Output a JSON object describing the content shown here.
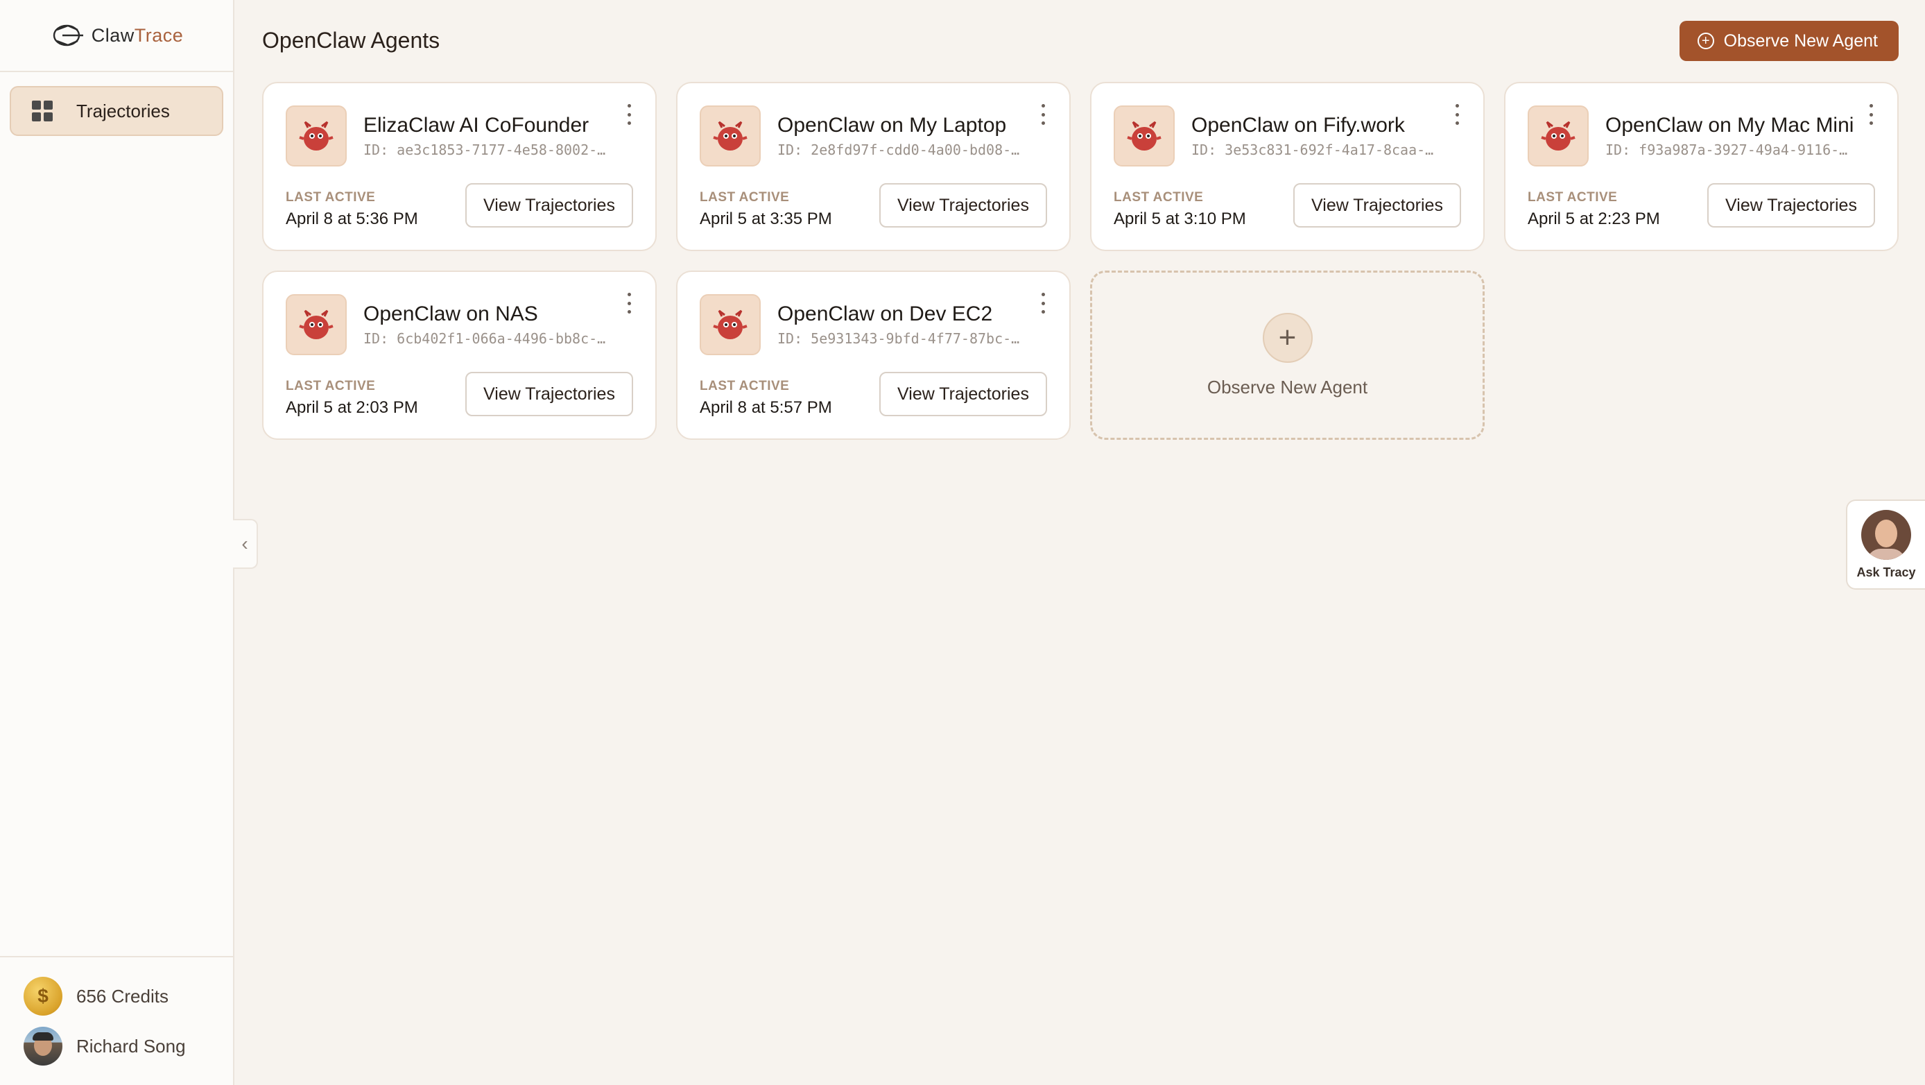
{
  "brand": {
    "name_part1": "Claw",
    "name_part2": "Trace"
  },
  "sidebar": {
    "items": [
      {
        "label": "Trajectories",
        "icon": "grid-icon",
        "active": true
      }
    ],
    "credits": "656 Credits",
    "user": "Richard Song"
  },
  "header": {
    "title": "OpenClaw Agents",
    "observe_button": "Observe New Agent"
  },
  "agents": [
    {
      "name": "ElizaClaw AI CoFounder",
      "id": "ID: ae3c1853-7177-4e58-8002-…",
      "last_active_label": "LAST ACTIVE",
      "last_active": "April 8 at 5:36 PM",
      "button": "View Trajectories"
    },
    {
      "name": "OpenClaw on My Laptop",
      "id": "ID: 2e8fd97f-cdd0-4a00-bd08-…",
      "last_active_label": "LAST ACTIVE",
      "last_active": "April 5 at 3:35 PM",
      "button": "View Trajectories"
    },
    {
      "name": "OpenClaw on Fify.work",
      "id": "ID: 3e53c831-692f-4a17-8caa-…",
      "last_active_label": "LAST ACTIVE",
      "last_active": "April 5 at 3:10 PM",
      "button": "View Trajectories"
    },
    {
      "name": "OpenClaw on My Mac Mini",
      "id": "ID: f93a987a-3927-49a4-9116-…",
      "last_active_label": "LAST ACTIVE",
      "last_active": "April 5 at 2:23 PM",
      "button": "View Trajectories"
    },
    {
      "name": "OpenClaw on NAS",
      "id": "ID: 6cb402f1-066a-4496-bb8c-…",
      "last_active_label": "LAST ACTIVE",
      "last_active": "April 5 at 2:03 PM",
      "button": "View Trajectories"
    },
    {
      "name": "OpenClaw on Dev EC2",
      "id": "ID: 5e931343-9bfd-4f77-87bc-…",
      "last_active_label": "LAST ACTIVE",
      "last_active": "April 8 at 5:57 PM",
      "button": "View Trajectories"
    }
  ],
  "add_card": {
    "label": "Observe New Agent",
    "icon": "plus-icon"
  },
  "assistant": {
    "label": "Ask Tracy"
  },
  "colors": {
    "accent": "#a3532b",
    "background": "#f7f3ee",
    "active_nav": "#f2e2d1"
  }
}
